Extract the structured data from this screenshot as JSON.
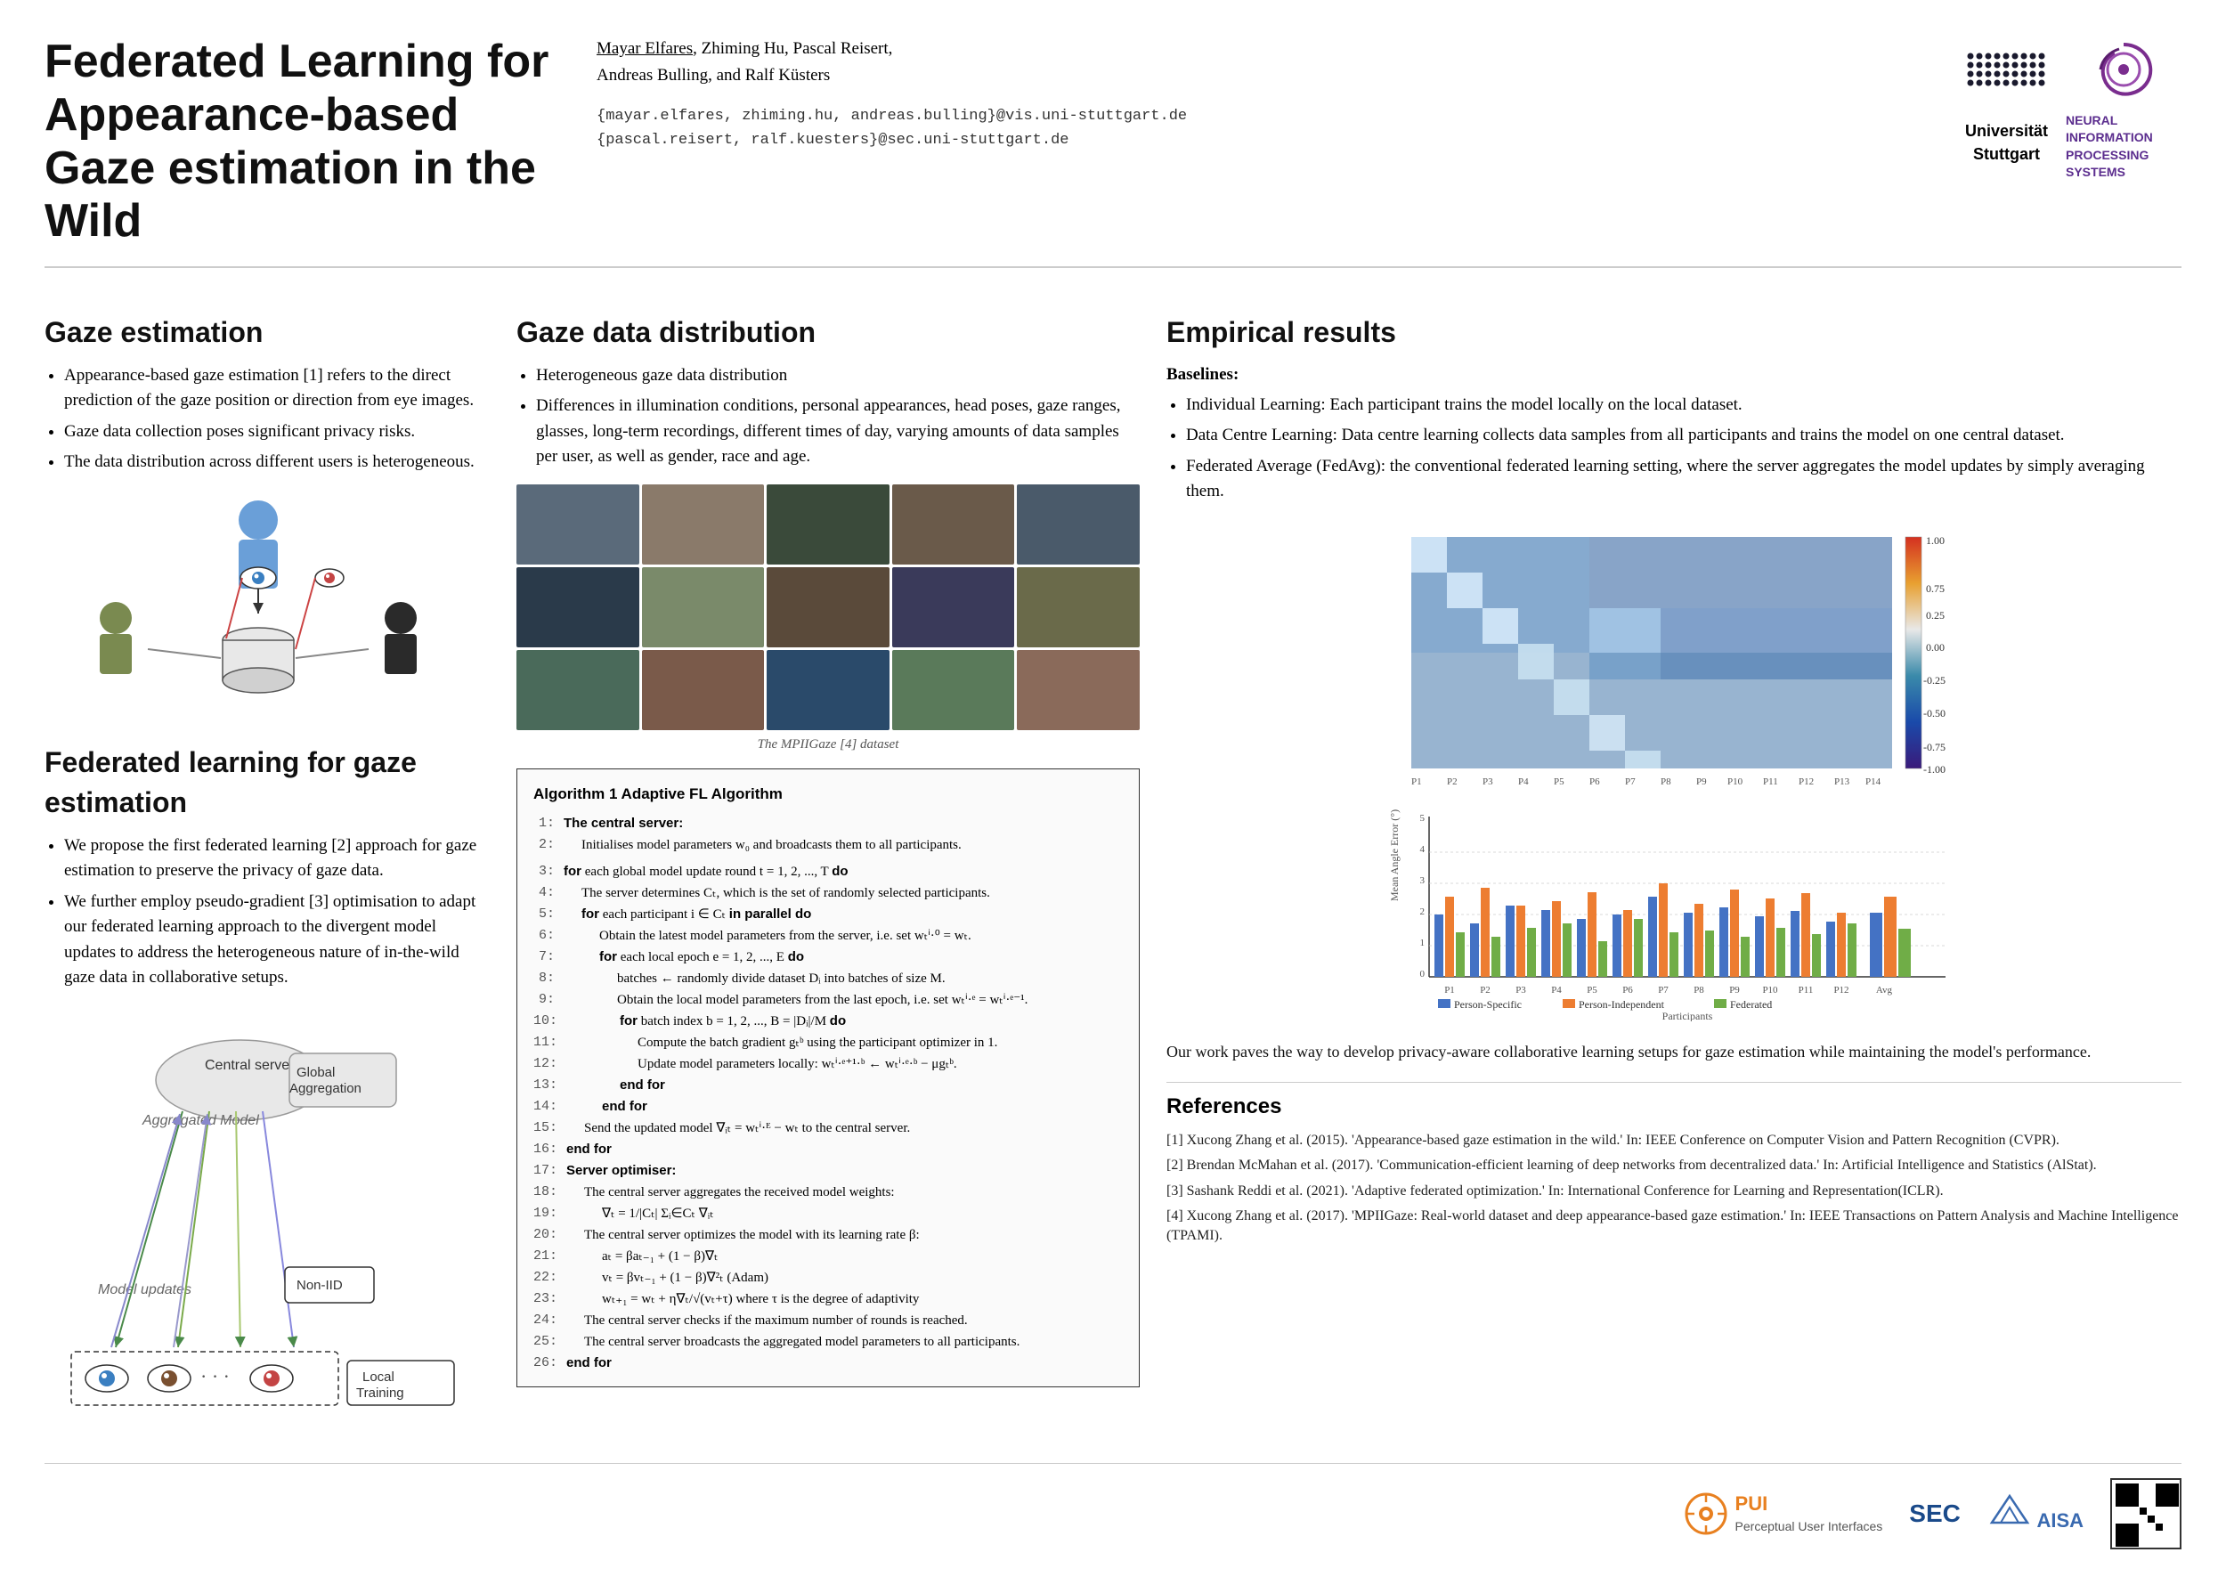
{
  "header": {
    "title_line1": "Federated Learning for Appearance-based",
    "title_line2": "Gaze estimation in the Wild",
    "authors": "Mayar Elfares, Zhiming Hu, Pascal Reisert,",
    "authors_line2": "Andreas Bulling, and Ralf Küsters",
    "emails_line1": "{mayar.elfares, zhiming.hu, andreas.bulling}@vis.uni-stuttgart.de",
    "emails_line2": "{pascal.reisert, ralf.kuesters}@sec.uni-stuttgart.de",
    "underlined_author": "Mayar Elfares",
    "unistuttgart_label": "Universität\nStuttgart",
    "nips_label": "NEURAL INFORMATION\nPROCESSING SYSTEMS"
  },
  "gaze_estimation": {
    "section_title": "Gaze estimation",
    "bullets": [
      "Appearance-based gaze estimation [1] refers to the direct prediction of the gaze position or direction from eye images.",
      "Gaze data collection poses significant privacy risks.",
      "The data distribution across different users is heterogeneous."
    ]
  },
  "federated_learning": {
    "section_title": "Federated learning for gaze estimation",
    "bullets": [
      "We propose the first federated learning [2] approach for gaze estimation to preserve the privacy of gaze data.",
      "We further employ pseudo-gradient [3] optimisation to adapt our federated learning approach to the divergent model updates to address the heterogeneous nature of in-the-wild gaze data in collaborative setups."
    ],
    "diagram_labels": {
      "central_server": "Central server",
      "global_aggregation": "Global\nAggregation",
      "aggregated_model": "Aggregated Model",
      "model_updates": "Model updates",
      "non_iid": "Non-IID",
      "local_training": "Local\nTraining"
    }
  },
  "gaze_data": {
    "section_title": "Gaze data distribution",
    "bullets": [
      "Heterogeneous gaze data distribution",
      "Differences in illumination conditions, personal appearances, head poses, gaze ranges, glasses, long-term recordings, different times of day, varying amounts of data samples per user, as well as gender, race and age."
    ],
    "image_caption": "The MPIIGaze [4] dataset",
    "algorithm": {
      "title": "Algorithm 1 Adaptive FL Algorithm",
      "lines": [
        {
          "num": "1:",
          "indent": 0,
          "text": "<b>The central server:</b>"
        },
        {
          "num": "2:",
          "indent": 1,
          "text": "Initialises model parameters w₀ and broadcasts them to all participants."
        },
        {
          "num": "",
          "indent": 0,
          "text": ""
        },
        {
          "num": "3:",
          "indent": 0,
          "text": "<b>for</b> each global model update round t = 1, 2, ..., T <b>do</b>"
        },
        {
          "num": "4:",
          "indent": 1,
          "text": "The server determines Cₜ, which is the set of randomly selected participants."
        },
        {
          "num": "5:",
          "indent": 1,
          "text": "<b>for</b> each participant i ∈ Cₜ <b>in parallel do</b>"
        },
        {
          "num": "6:",
          "indent": 2,
          "text": "Obtain the latest model parameters from the server, i.e. set wₜⁱ·⁰ = wₜ."
        },
        {
          "num": "7:",
          "indent": 2,
          "text": "<b>for</b> each local epoch e = 1, 2, ..., E <b>do</b>"
        },
        {
          "num": "8:",
          "indent": 3,
          "text": "batches ← randomly divide dataset Dᵢ into batches of size M."
        },
        {
          "num": "9:",
          "indent": 3,
          "text": "Obtain the local model parameters from the last epoch, i.e. set wₜⁱ·ᵉ = wₜⁱ·ᵉ⁻¹."
        },
        {
          "num": "10:",
          "indent": 3,
          "text": "<b>for</b> batch index b = 1, 2, ..., B = |Dᵢ|/M <b>do</b>"
        },
        {
          "num": "11:",
          "indent": 4,
          "text": "Compute the batch gradient gₜᵇ using the participant optimizer in 1."
        },
        {
          "num": "12:",
          "indent": 4,
          "text": "Update model parameters locally: wₜⁱ·ᵉ⁺¹·ᵇ ← wₜⁱ·ᵉ·ᵇ − μgₜᵇ."
        },
        {
          "num": "13:",
          "indent": 3,
          "text": "<b>end for</b>"
        },
        {
          "num": "14:",
          "indent": 2,
          "text": "<b>end for</b>"
        },
        {
          "num": "15:",
          "indent": 1,
          "text": "Send the updated model ∇ᵢₜ = wₜⁱ·ᴱ − wₜ to the central server."
        },
        {
          "num": "16:",
          "indent": 0,
          "text": "<b>end for</b>"
        },
        {
          "num": "17:",
          "indent": 0,
          "text": "<b>Server optimiser:</b>"
        },
        {
          "num": "18:",
          "indent": 1,
          "text": "The central server aggregates the received model weights:"
        },
        {
          "num": "19:",
          "indent": 2,
          "text": "∇ₜ = 1/|Cₜ| Σᵢ∈Cₜ ∇ᵢₜ"
        },
        {
          "num": "20:",
          "indent": 1,
          "text": "The central server optimizes the model with its learning rate β:"
        },
        {
          "num": "21:",
          "indent": 2,
          "text": "aₜ = βaₜ₋₁ + (1 − β)∇ₜ"
        },
        {
          "num": "22:",
          "indent": 2,
          "text": "vₜ = βvₜ₋₁ + (1 − β)∇²ₜ (Adam)"
        },
        {
          "num": "23:",
          "indent": 2,
          "text": "wₜ₊₁ = wₜ + η∇ₜ/√(vₜ+τ) where τ is the degree of adaptivity"
        },
        {
          "num": "24:",
          "indent": 1,
          "text": "The central server checks if the maximum number of rounds is reached."
        },
        {
          "num": "25:",
          "indent": 1,
          "text": "The central server broadcasts the aggregated model parameters to all participants."
        },
        {
          "num": "26:",
          "indent": 0,
          "text": "<b>end for</b>"
        }
      ]
    }
  },
  "empirical": {
    "section_title": "Empirical results",
    "baselines_label": "Baselines:",
    "baselines": [
      "Individual Learning: Each participant trains the model locally on the local dataset.",
      "Data Centre Learning: Data centre learning collects data samples from all participants and trains the model on one central dataset.",
      "Federated Average (FedAvg): the conventional federated learning setting, where the server aggregates the model updates by simply averaging them."
    ],
    "conclusion": "Our work paves the way to develop privacy-aware collaborative learning setups for gaze estimation while maintaining the model's performance."
  },
  "references": {
    "title": "References",
    "items": [
      "[1] Xucong Zhang et al. (2015). 'Appearance-based gaze estimation in the wild.' In: IEEE Conference on Computer Vision and Pattern Recognition (CVPR).",
      "[2] Brendan McMahan et al. (2017). 'Communication-efficient learning of deep networks from decentralized data.' In: Artificial Intelligence and Statistics (AlStat).",
      "[3] Sashank Reddi et al. (2021). 'Adaptive federated optimization.' In: International Conference for Learning and Representation(ICLR).",
      "[4] Xucong Zhang et al. (2017). 'MPIIGaze: Real-world dataset and deep appearance-based gaze estimation.' In: IEEE Transactions on Pattern Analysis and Machine Intelligence (TPAMI)."
    ]
  },
  "bottom_logos": {
    "pui_label": "PUI",
    "pui_sublabel": "Perceptual\nUser Interfaces",
    "sec_label": "SEC",
    "aisa_label": "AISA"
  }
}
